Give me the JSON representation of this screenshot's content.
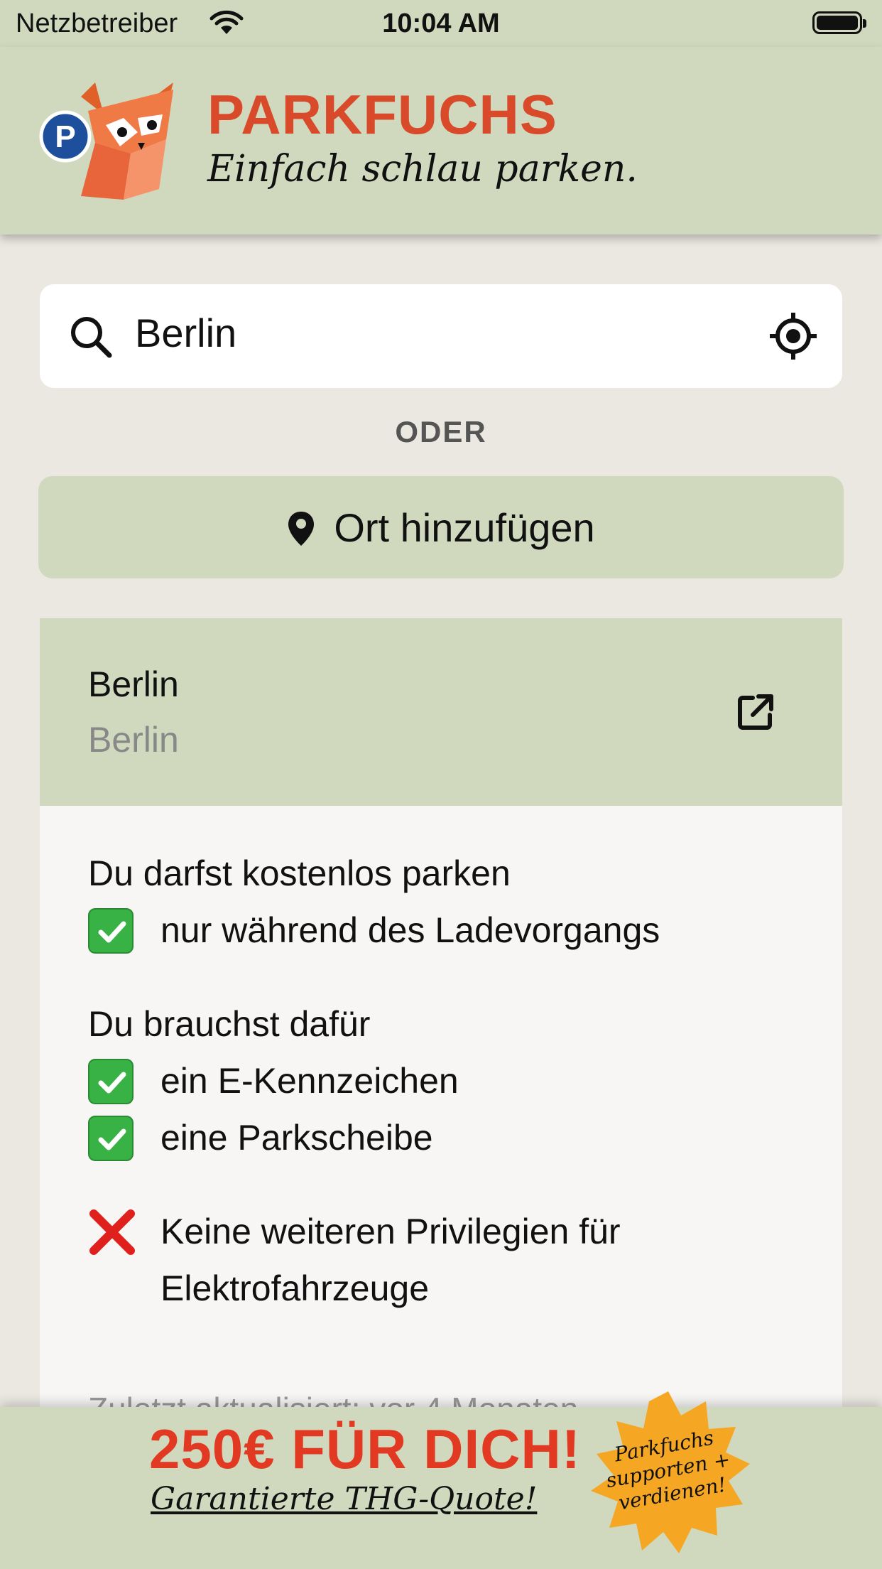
{
  "status_bar": {
    "carrier": "Netzbetreiber",
    "time": "10:04 AM"
  },
  "header": {
    "brand": "PARKFUCHS",
    "slogan": "Einfach schlau parken."
  },
  "search": {
    "value": "Berlin"
  },
  "divider_text": "ODER",
  "add_location": {
    "label": "Ort hinzufügen"
  },
  "result": {
    "city": "Berlin",
    "region": "Berlin",
    "free_parking_heading": "Du darfst kostenlos parken",
    "free_parking_condition": "nur während des Ladevorgangs",
    "requirements_heading": "Du brauchst dafür",
    "requirements": [
      "ein E-Kennzeichen",
      "eine Parkscheibe"
    ],
    "no_privileges_line1": "Keine weiteren Privilegien für",
    "no_privileges_line2": "Elektrofahrzeuge",
    "updated_partial": "Zuletzt aktualisiert: vor 4 Monaten"
  },
  "promo": {
    "title": "250€ FÜR DICH!",
    "subtitle": "Garantierte THG-Quote!",
    "badge_lines": [
      "Parkfuchs",
      "supporten +",
      "verdienen!"
    ]
  },
  "colors": {
    "header_bg": "#d0d9bd",
    "brand": "#d94a2b",
    "promo_red": "#e23a22",
    "badge": "#f5a623",
    "check_green": "#38b245",
    "cross_red": "#e0201c"
  },
  "icons": [
    "wifi-icon",
    "battery-icon",
    "fox-logo",
    "search-icon",
    "location-target-icon",
    "map-pin-icon",
    "external-link-icon",
    "check-icon",
    "cross-icon"
  ]
}
